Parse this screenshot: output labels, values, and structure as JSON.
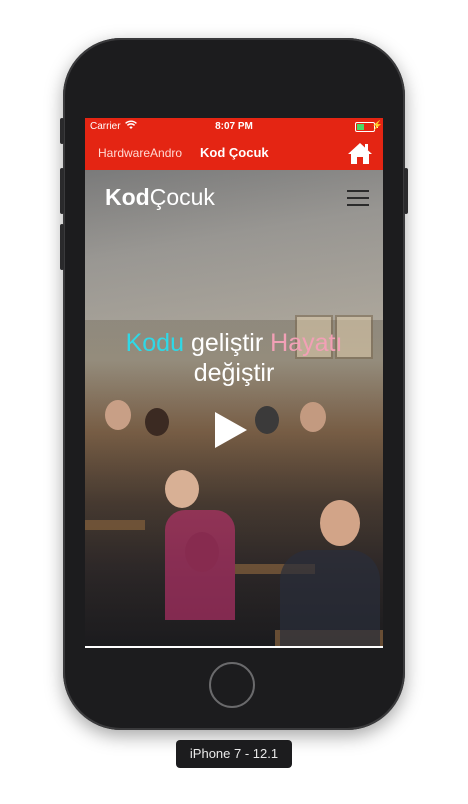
{
  "status_bar": {
    "carrier": "Carrier",
    "time": "8:07 PM"
  },
  "app_bar": {
    "tab_1": "HardwareAndro",
    "tab_2": "Kod Çocuk",
    "home_icon": "home-icon"
  },
  "site": {
    "logo_bold": "Kod",
    "logo_regular": "Çocuk",
    "headline": {
      "word1": "Kodu",
      "word2": "geliştir",
      "word3": "Hayatı",
      "word4": "değiştir"
    },
    "menu_icon": "hamburger-icon",
    "play_icon": "play-icon"
  },
  "colors": {
    "app_bar": "#e42513",
    "cyan_word": "#2fd8e6",
    "pink_word": "#f2a0b6"
  },
  "device_label": "iPhone 7 - 12.1"
}
